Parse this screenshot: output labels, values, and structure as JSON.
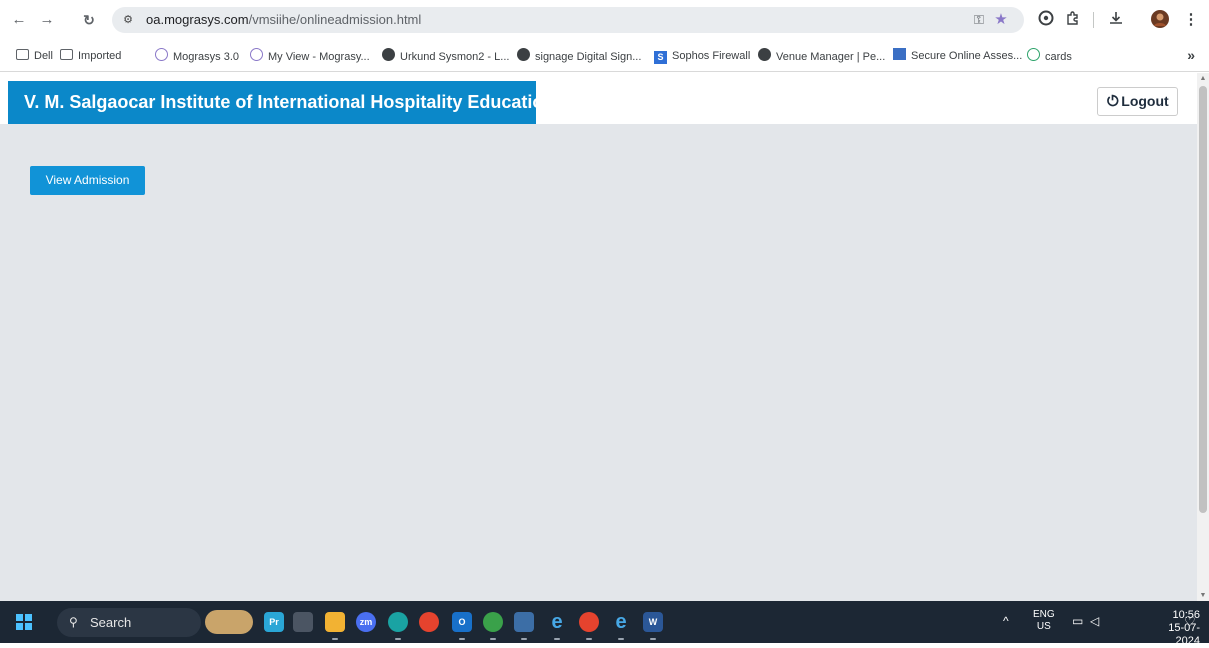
{
  "browser": {
    "url_host": "oa.mograsys.com",
    "url_path": "/vmsiihe/onlineadmission.html",
    "icons": [
      "back-icon",
      "forward-icon",
      "reload-icon",
      "site-info-icon",
      "password-key-icon",
      "bookmark-star-icon",
      "extension-g-icon",
      "extensions-puzzle-icon",
      "downloads-icon",
      "profile-avatar",
      "menu-kebab-icon"
    ]
  },
  "bookmarks": [
    {
      "label": "Dell",
      "icon": "folder-icon"
    },
    {
      "label": "Imported",
      "icon": "folder-icon"
    },
    {
      "label": "Mograsys 3.0",
      "icon": "mograsys-icon"
    },
    {
      "label": "My View - Mograsy...",
      "icon": "mograsys-icon"
    },
    {
      "label": "Urkund Sysmon2 - L...",
      "icon": "globe-icon"
    },
    {
      "label": "signage Digital Sign...",
      "icon": "globe-icon"
    },
    {
      "label": "Sophos Firewall",
      "icon": "sophos-icon"
    },
    {
      "label": "Venue Manager | Pe...",
      "icon": "globe-icon"
    },
    {
      "label": "Secure Online Asses...",
      "icon": "sheet-icon"
    },
    {
      "label": "cards",
      "icon": "cards-icon"
    }
  ],
  "bookmarks_more": "»",
  "app": {
    "title": "V. M. Salgaocar Institute of International Hospitality Education",
    "logout_label": "Logout",
    "view_admission_label": "View Admission",
    "brand_color": "#0b88c9",
    "button_color": "#1193d7",
    "background_color": "#e3e6ea"
  },
  "taskbar": {
    "search_label": "Search",
    "apps": [
      "weather-widget",
      "premiere-pro",
      "app-generic",
      "file-explorer",
      "zoom",
      "edge",
      "chrome",
      "outlook",
      "sync-app",
      "remote-desktop",
      "internet-explorer",
      "chrome-active",
      "internet-explorer-2",
      "word"
    ],
    "lang_top": "ENG",
    "lang_bottom": "US",
    "time": "10:56",
    "date": "15-07-2024"
  }
}
